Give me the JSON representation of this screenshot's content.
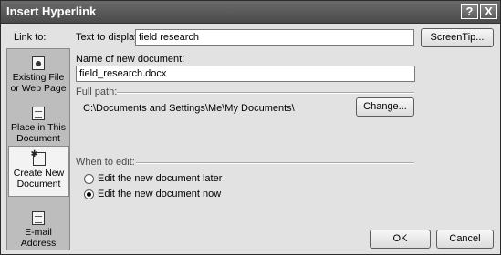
{
  "window": {
    "title": "Insert Hyperlink",
    "help_glyph": "?",
    "close_glyph": "X"
  },
  "link_to": {
    "label": "Link to:",
    "items": [
      {
        "label": "Existing File or Web Page",
        "icon": "globe-document-icon",
        "selected": false
      },
      {
        "label": "Place in This Document",
        "icon": "document-bookmark-icon",
        "selected": false
      },
      {
        "label": "Create New Document",
        "icon": "new-document-icon",
        "selected": true
      },
      {
        "label": "E-mail Address",
        "icon": "email-icon",
        "selected": false
      }
    ]
  },
  "text_to_display": {
    "label": "Text to display:",
    "value": "field research"
  },
  "screentip_button": "ScreenTip...",
  "new_document": {
    "label": "Name of new document:",
    "value": "field_research.docx"
  },
  "full_path": {
    "label": "Full path:",
    "value": "C:\\Documents and Settings\\Me\\My Documents\\"
  },
  "change_button": "Change...",
  "when_to_edit": {
    "label": "When to edit:",
    "options": [
      {
        "label": "Edit the new document later",
        "selected": false
      },
      {
        "label": "Edit the new document now",
        "selected": true
      }
    ]
  },
  "ok_button": "OK",
  "cancel_button": "Cancel"
}
